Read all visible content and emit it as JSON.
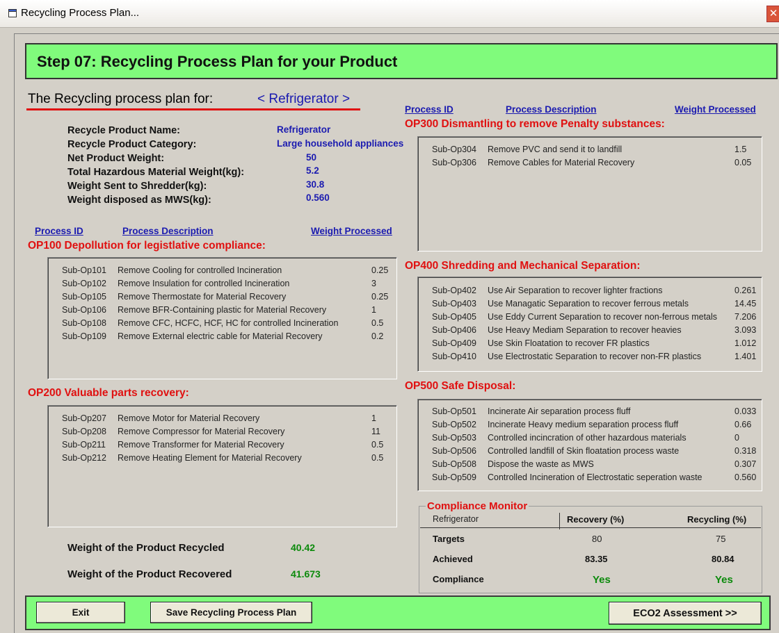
{
  "window": {
    "title": "Recycling Process Plan..."
  },
  "header": {
    "step_title": "Step 07: Recycling Process Plan for your Product"
  },
  "plan": {
    "label": "The Recycling process plan for:",
    "product": "< Refrigerator >"
  },
  "product_info": [
    {
      "label": "Recycle Product Name:",
      "value": "Refrigerator"
    },
    {
      "label": "Recycle Product Category:",
      "value": "Large household appliances"
    },
    {
      "label": "Net Product Weight:",
      "value": "50"
    },
    {
      "label": "Total Hazardous Material Weight(kg):",
      "value": "5.2"
    },
    {
      "label": "Weight Sent to Shredder(kg):",
      "value": "30.8"
    },
    {
      "label": "Weight disposed as MWS(kg):",
      "value": "0.560"
    }
  ],
  "columns": {
    "id": "Process ID",
    "desc": "Process Description",
    "weight": "Weight Processed"
  },
  "ops": {
    "op100": {
      "title": "OP100  Depollution for legistlative compliance:",
      "rows": [
        {
          "id": "Sub-Op101",
          "desc": "Remove Cooling for controlled Incineration",
          "w": "0.25"
        },
        {
          "id": "Sub-Op102",
          "desc": "Remove Insulation for controlled Incineration",
          "w": "3"
        },
        {
          "id": "Sub-Op105",
          "desc": "Remove Thermostate for Material Recovery",
          "w": "0.25"
        },
        {
          "id": "Sub-Op106",
          "desc": "Remove BFR-Containing plastic for Material Recovery",
          "w": "1"
        },
        {
          "id": "Sub-Op108",
          "desc": "Remove CFC, HCFC, HCF, HC for controlled Incineration",
          "w": "0.5"
        },
        {
          "id": "Sub-Op109",
          "desc": "Remove External electric cable for Material Recovery",
          "w": "0.2"
        }
      ]
    },
    "op200": {
      "title": "OP200  Valuable parts recovery:",
      "rows": [
        {
          "id": "Sub-Op207",
          "desc": "Remove Motor for Material Recovery",
          "w": "1"
        },
        {
          "id": "Sub-Op208",
          "desc": "Remove Compressor for Material Recovery",
          "w": "11"
        },
        {
          "id": "Sub-Op211",
          "desc": "Remove Transformer for Material Recovery",
          "w": "0.5"
        },
        {
          "id": "Sub-Op212",
          "desc": "Remove Heating Element for Material Recovery",
          "w": "0.5"
        }
      ]
    },
    "op300": {
      "title": "OP300  Dismantling to remove Penalty substances:",
      "rows": [
        {
          "id": "Sub-Op304",
          "desc": "Remove PVC and send it to landfill",
          "w": "1.5"
        },
        {
          "id": "Sub-Op306",
          "desc": "Remove Cables for Material Recovery",
          "w": "0.05"
        }
      ]
    },
    "op400": {
      "title": "OP400 Shredding and Mechanical Separation:",
      "rows": [
        {
          "id": "Sub-Op402",
          "desc": "Use Air Separation to recover lighter fractions",
          "w": "0.261"
        },
        {
          "id": "Sub-Op403",
          "desc": "Use Managatic Separation to recover ferrous metals",
          "w": "14.45"
        },
        {
          "id": "Sub-Op405",
          "desc": "Use Eddy Current Separation to recover non-ferrous metals",
          "w": "7.206"
        },
        {
          "id": "Sub-Op406",
          "desc": "Use Heavy Mediam Separation to recover heavies",
          "w": "3.093"
        },
        {
          "id": "Sub-Op409",
          "desc": "Use Skin Floatation to recover FR plastics",
          "w": "1.012"
        },
        {
          "id": "Sub-Op410",
          "desc": "Use Electrostatic Separation to recover non-FR plastics",
          "w": "1.401"
        }
      ]
    },
    "op500": {
      "title": "OP500 Safe Disposal:",
      "rows": [
        {
          "id": "Sub-Op501",
          "desc": "Incinerate Air separation process fluff",
          "w": "0.033"
        },
        {
          "id": "Sub-Op502",
          "desc": "Incinerate Heavy medium separation process fluff",
          "w": "0.66"
        },
        {
          "id": "Sub-Op503",
          "desc": "Controlled incincration of other hazardous materials",
          "w": "0"
        },
        {
          "id": "Sub-Op506",
          "desc": "Controlled landfill of Skin floatation process waste",
          "w": "0.318"
        },
        {
          "id": "Sub-Op508",
          "desc": "Dispose the waste as MWS",
          "w": "0.307"
        },
        {
          "id": "Sub-Op509",
          "desc": "Controlled Incineration of Electrostatic seperation waste",
          "w": "0.560"
        }
      ]
    }
  },
  "totals": {
    "recycled_label": "Weight of the Product Recycled",
    "recycled_value": "40.42",
    "recovered_label": "Weight of the Product Recovered",
    "recovered_value": "41.673"
  },
  "compliance": {
    "legend": "Compliance Monitor",
    "product": "Refrigerator",
    "col_recovery": "Recovery (%)",
    "col_recycling": "Recycling (%)",
    "targets_label": "Targets",
    "targets_recovery": "80",
    "targets_recycling": "75",
    "achieved_label": "Achieved",
    "achieved_recovery": "83.35",
    "achieved_recycling": "80.84",
    "compliance_label": "Compliance",
    "compliance_recovery": "Yes",
    "compliance_recycling": "Yes"
  },
  "buttons": {
    "exit": "Exit",
    "save": "Save Recycling Process Plan",
    "eco": "ECO2 Assessment >>"
  }
}
